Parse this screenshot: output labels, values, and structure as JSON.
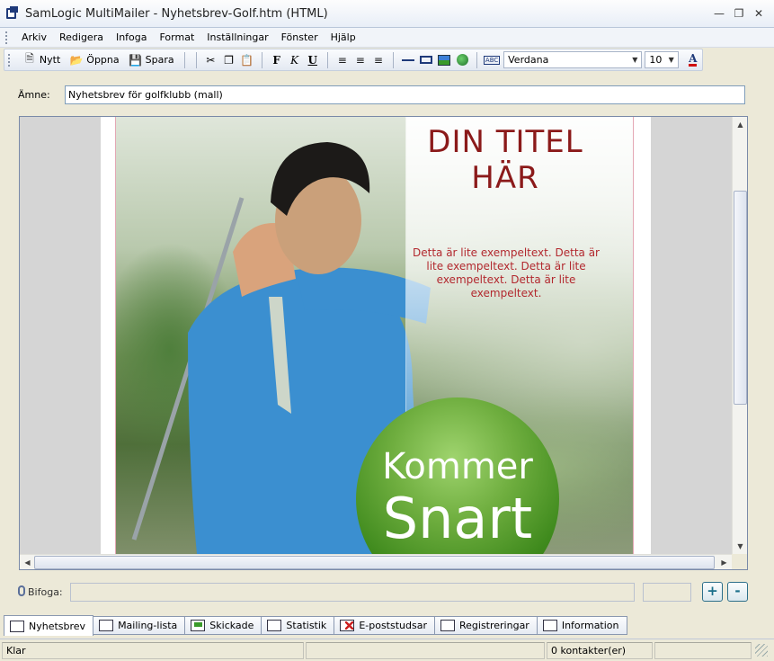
{
  "window": {
    "title": "SamLogic MultiMailer - Nyhetsbrev-Golf.htm  (HTML)",
    "buttons": [
      "minimize",
      "restore",
      "close"
    ]
  },
  "menu": [
    "Arkiv",
    "Redigera",
    "Infoga",
    "Format",
    "Inställningar",
    "Fönster",
    "Hjälp"
  ],
  "toolbar": {
    "new_label": "Nytt",
    "open_label": "Öppna",
    "save_label": "Spara",
    "font": "Verdana",
    "size": "10",
    "icons": [
      "cut-icon",
      "copy-icon",
      "paste-icon",
      "bold-icon",
      "italic-icon",
      "underline-icon",
      "align-left-icon",
      "align-center-icon",
      "align-right-icon",
      "horizontal-line-icon",
      "insert-box-icon",
      "insert-image-icon",
      "insert-link-icon",
      "spellcheck-icon",
      "font-color-icon"
    ],
    "bold_glyph": "F",
    "italic_glyph": "K",
    "underline_glyph": "U",
    "spell_glyph": "ABC",
    "color_glyph": "A"
  },
  "subject": {
    "label": "Ämne:",
    "value": "Nyhetsbrev för golfklubb (mall)"
  },
  "newsletter": {
    "title_line1": "DIN TITEL",
    "title_line2": "HÄR",
    "body": "Detta är lite exempeltext. Detta är lite exempeltext. Detta är lite exempeltext. Detta är lite exempeltext.",
    "badge_top": "Kommer",
    "badge_bottom": "Snart",
    "colors": {
      "title": "#8b1a1a",
      "body": "#b2282e",
      "badge": "#4f9a2a"
    }
  },
  "attach": {
    "label": "Bifoga:",
    "add": "+",
    "remove": "-"
  },
  "tabs": [
    {
      "label": "Nyhetsbrev",
      "active": true
    },
    {
      "label": "Mailing-lista",
      "active": false
    },
    {
      "label": "Skickade",
      "active": false
    },
    {
      "label": "Statistik",
      "active": false
    },
    {
      "label": "E-poststudsar",
      "active": false
    },
    {
      "label": "Registreringar",
      "active": false
    },
    {
      "label": "Information",
      "active": false
    }
  ],
  "status": {
    "state": "Klar",
    "contacts": "0 kontakter(er)"
  }
}
